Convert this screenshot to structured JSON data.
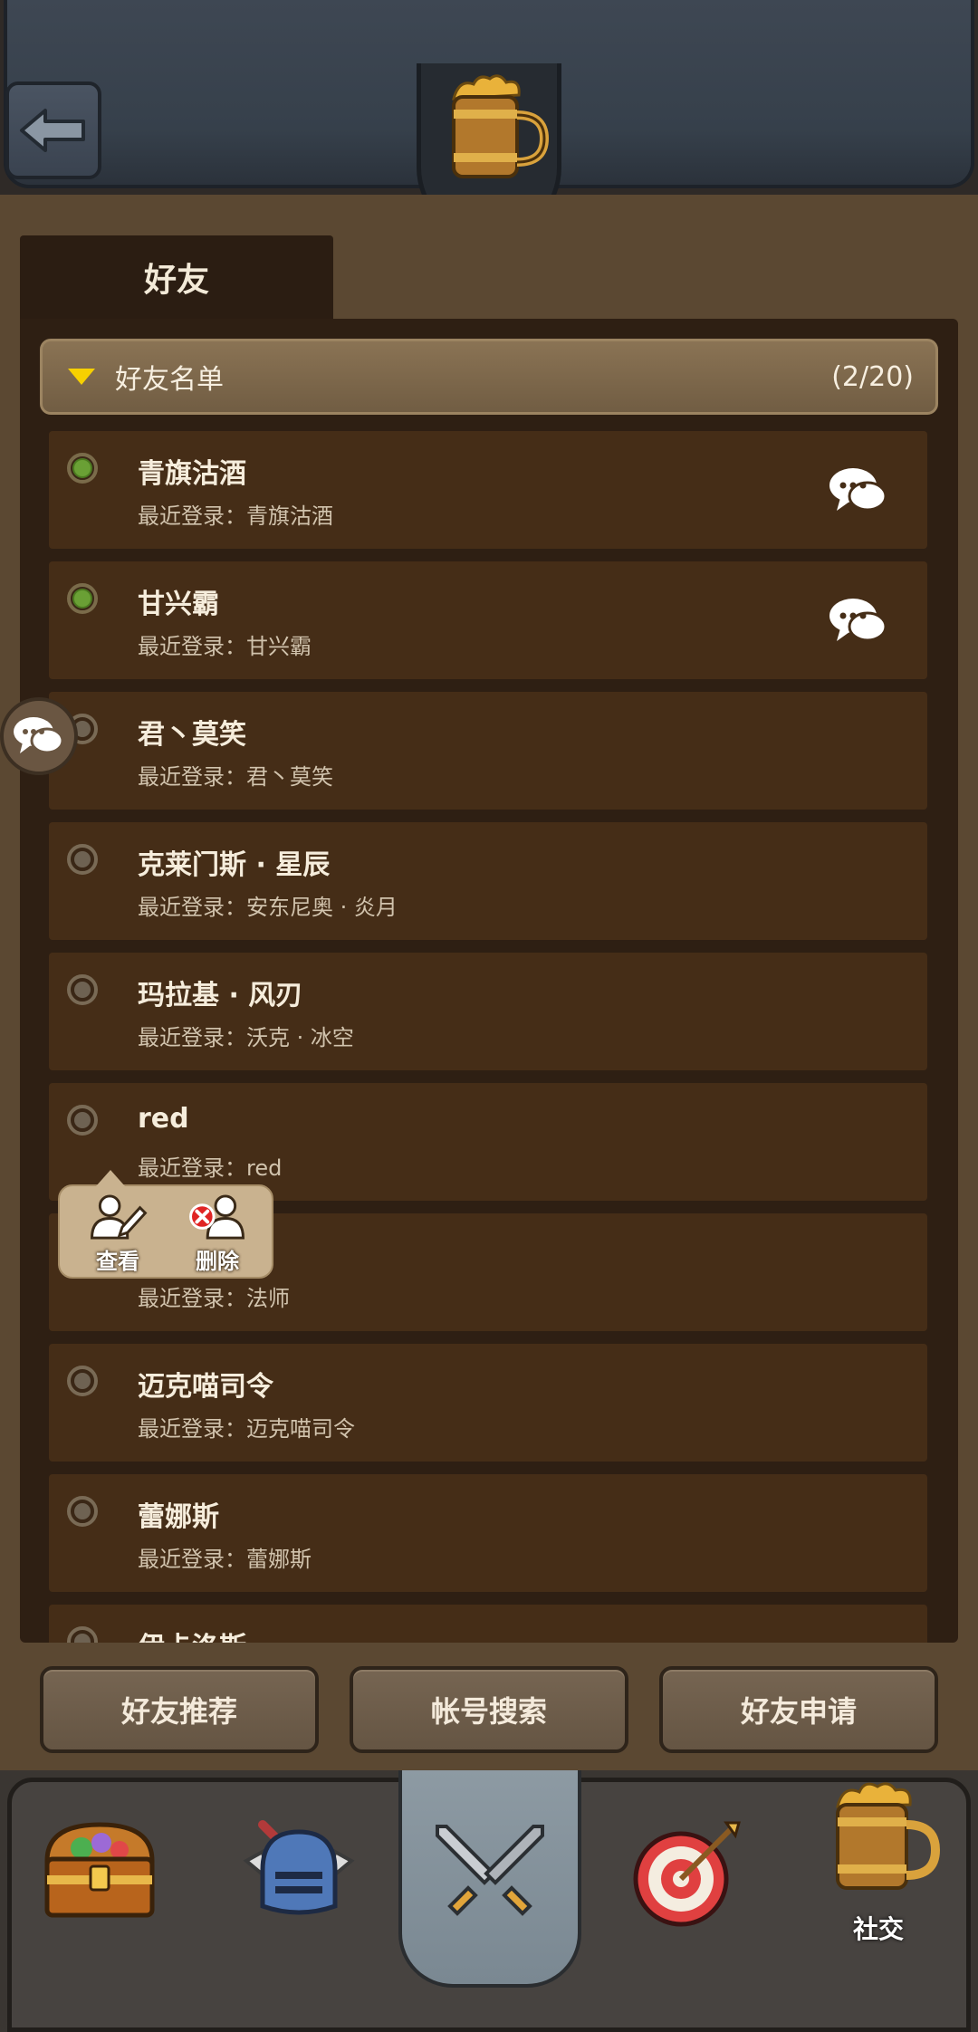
{
  "header": {
    "back_icon": "back-arrow-icon",
    "emblem_icon": "beer-mug-icon"
  },
  "tab": {
    "label": "好友"
  },
  "friend_list": {
    "group_label": "好友名单",
    "count": "(2/20)",
    "last_login_prefix": "最近登录：",
    "items": [
      {
        "name": "青旗沽酒",
        "last_login": "最近登录：青旗沽酒",
        "online": true,
        "chat": true
      },
      {
        "name": "甘兴霸",
        "last_login": "最近登录：甘兴霸",
        "online": true,
        "chat": true
      },
      {
        "name": "君丶莫笑",
        "last_login": "最近登录：君丶莫笑",
        "online": false,
        "chat": false
      },
      {
        "name": "克莱门斯 · 星辰",
        "last_login": "最近登录：安东尼奥 · 炎月",
        "online": false,
        "chat": false
      },
      {
        "name": "玛拉基 · 风刃",
        "last_login": "最近登录：沃克 · 冰空",
        "online": false,
        "chat": false
      },
      {
        "name": "red",
        "last_login": "最近登录：red",
        "online": false,
        "chat": false
      },
      {
        "name": "",
        "last_login": "最近登录：法师",
        "online": false,
        "chat": false
      },
      {
        "name": "迈克喵司令",
        "last_login": "最近登录：迈克喵司令",
        "online": false,
        "chat": false
      },
      {
        "name": "蕾娜斯",
        "last_login": "最近登录：蕾娜斯",
        "online": false,
        "chat": false
      },
      {
        "name": "伊卡洛斯",
        "last_login": "",
        "online": false,
        "chat": false
      }
    ]
  },
  "popup_menu": {
    "view_label": "查看",
    "delete_label": "删除"
  },
  "actions": {
    "recommend_label": "好友推荐",
    "search_label": "帐号搜索",
    "requests_label": "好友申请"
  },
  "nav": {
    "items": [
      {
        "icon": "treasure-chest-icon",
        "label": ""
      },
      {
        "icon": "knight-helmet-icon",
        "label": ""
      },
      {
        "icon": "crossed-swords-icon",
        "label": ""
      },
      {
        "icon": "target-arrows-icon",
        "label": ""
      },
      {
        "icon": "beer-mug-icon",
        "label": "社交"
      }
    ],
    "active_index": 2
  },
  "colors": {
    "online": "#6aa035",
    "panel": "#5b4832",
    "row": "#452d17",
    "header_bar": "#8a7354",
    "triangle": "#f7d000"
  }
}
